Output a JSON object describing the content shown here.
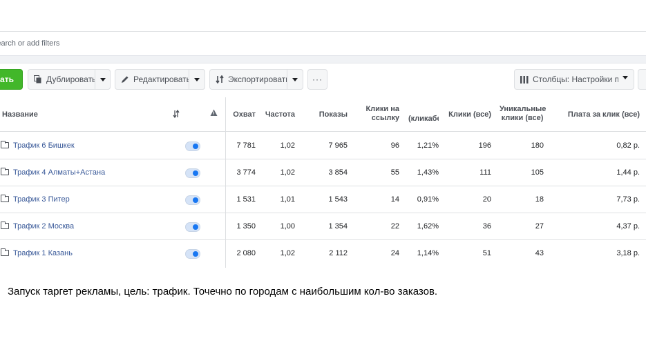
{
  "search": {
    "placeholder": "Search or add filters"
  },
  "toolbar": {
    "create_label": "Создать",
    "duplicate_label": "Дублировать",
    "edit_label": "Редактировать",
    "export_label": "Экспортировать",
    "more_label": "···",
    "columns_label": "Столбцы: Настройки пользователя"
  },
  "table": {
    "headers": {
      "name": "Название",
      "reach": "Охват",
      "frequency": "Частота",
      "impressions": "Показы",
      "link_clicks_line1": "Клики на",
      "link_clicks_line2": "ссылку",
      "ctr": "(кликабельность)",
      "clicks_all": "Клики (все)",
      "unique_clicks_line1": "Уникальные",
      "unique_clicks_line2": "клики (все)",
      "cpc": "Плата за клик (все)"
    },
    "rows": [
      {
        "name": "Трафик 6 Бишкек",
        "reach": "7 781",
        "frequency": "1,02",
        "impressions": "7 965",
        "link_clicks": "96",
        "ctr": "1,21%",
        "clicks_all": "196",
        "unique_clicks": "180",
        "cpc": "0,82 р."
      },
      {
        "name": "Трафик 4 Алматы+Астана",
        "reach": "3 774",
        "frequency": "1,02",
        "impressions": "3 854",
        "link_clicks": "55",
        "ctr": "1,43%",
        "clicks_all": "111",
        "unique_clicks": "105",
        "cpc": "1,44 р."
      },
      {
        "name": "Трафик 3 Питер",
        "reach": "1 531",
        "frequency": "1,01",
        "impressions": "1 543",
        "link_clicks": "14",
        "ctr": "0,91%",
        "clicks_all": "20",
        "unique_clicks": "18",
        "cpc": "7,73 р."
      },
      {
        "name": "Трафик 2 Москва",
        "reach": "1 350",
        "frequency": "1,00",
        "impressions": "1 354",
        "link_clicks": "22",
        "ctr": "1,62%",
        "clicks_all": "36",
        "unique_clicks": "27",
        "cpc": "4,37 р."
      },
      {
        "name": "Трафик 1 Казань",
        "reach": "2 080",
        "frequency": "1,02",
        "impressions": "2 112",
        "link_clicks": "24",
        "ctr": "1,14%",
        "clicks_all": "51",
        "unique_clicks": "43",
        "cpc": "3,18 р."
      }
    ]
  },
  "caption": "Запуск таргет рекламы, цель: трафик. Точечно по городам с наибольшим кол-во заказов.",
  "colors": {
    "accent": "#1877f2",
    "create_green": "#42b72a",
    "link": "#385898"
  }
}
